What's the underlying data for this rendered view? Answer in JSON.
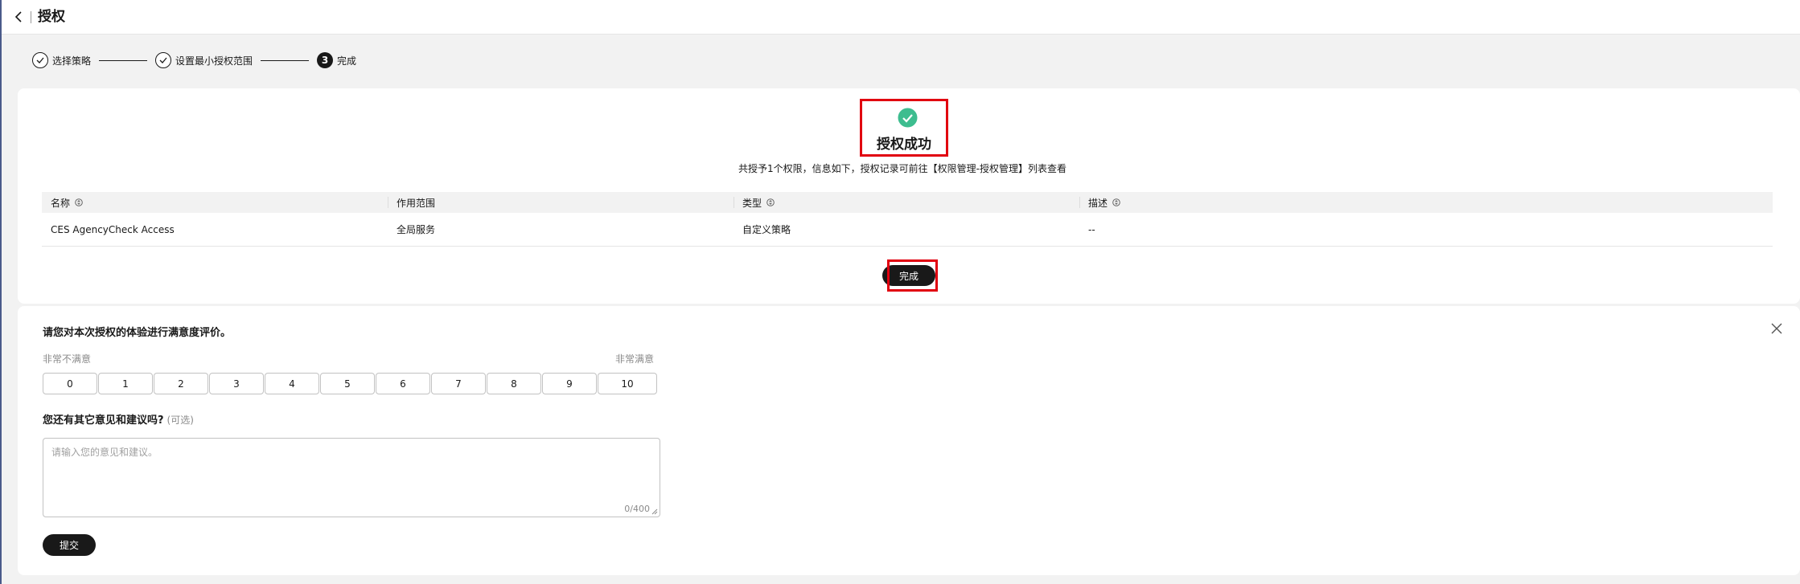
{
  "header": {
    "title": "授权",
    "back_icon": "chevron-left-icon"
  },
  "stepper": {
    "steps": [
      {
        "label": "选择策略",
        "state": "done"
      },
      {
        "label": "设置最小授权范围",
        "state": "done"
      },
      {
        "label": "完成",
        "state": "active",
        "number": "3"
      }
    ]
  },
  "result": {
    "icon": "check-circle-icon",
    "title": "授权成功",
    "description": "共授予1个权限，信息如下，授权记录可前往【权限管理-授权管理】列表查看",
    "accent_color": "#3dbd8f",
    "highlight_color": "#e1000f"
  },
  "table": {
    "columns": [
      "名称",
      "作用范围",
      "类型",
      "描述"
    ],
    "rows": [
      {
        "name": "CES AgencyCheck Access",
        "scope": "全局服务",
        "type": "自定义策略",
        "description": "--"
      }
    ]
  },
  "done_button": {
    "label": "完成"
  },
  "survey": {
    "title": "请您对本次授权的体验进行满意度评价。",
    "scale_low_label": "非常不满意",
    "scale_high_label": "非常满意",
    "scale": [
      "0",
      "1",
      "2",
      "3",
      "4",
      "5",
      "6",
      "7",
      "8",
      "9",
      "10"
    ],
    "feedback_label": "您还有其它意见和建议吗?",
    "feedback_optional": "(可选)",
    "feedback_placeholder": "请输入您的意见和建议。",
    "feedback_counter": "0/400",
    "submit_label": "提交",
    "close_icon": "close-icon"
  }
}
